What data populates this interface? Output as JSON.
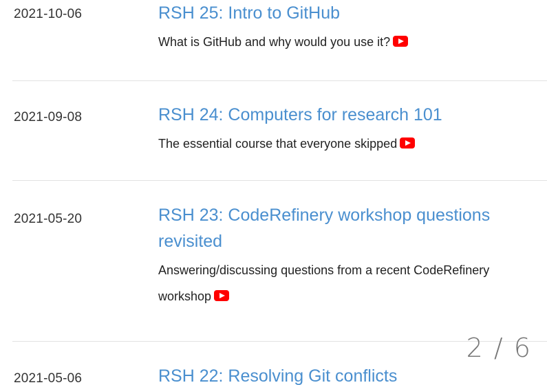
{
  "episodes": [
    {
      "date": "2021-10-06",
      "title": "RSH 25: Intro to GitHub",
      "description": "What is GitHub and why would you use it?",
      "video_icon": "youtube-icon"
    },
    {
      "date": "2021-09-08",
      "title": "RSH 24: Computers for research 101",
      "description": "The essential course that everyone skipped",
      "video_icon": "youtube-icon"
    },
    {
      "date": "2021-05-20",
      "title": "RSH 23: CodeRefinery workshop questions revisited",
      "description": "Answering/discussing questions from a recent CodeRefinery workshop",
      "video_icon": "youtube-icon"
    },
    {
      "date": "2021-05-06",
      "title": "RSH 22: Resolving Git conflicts",
      "description": "",
      "video_icon": ""
    }
  ],
  "slide_counter": "2 / 6",
  "colors": {
    "link": "#4a8fcf",
    "text": "#333333",
    "divider": "#e2e2e2",
    "youtube": "#ff0000"
  }
}
